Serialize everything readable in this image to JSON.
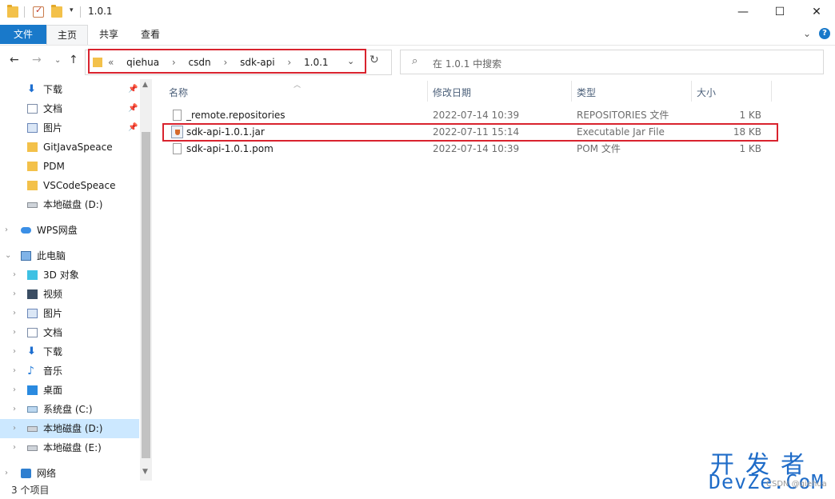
{
  "window": {
    "title": "1.0.1",
    "controls": {
      "minimize": "—",
      "maximize": "☐",
      "close": "✕"
    }
  },
  "ribbon": {
    "tabs": [
      "文件",
      "主页",
      "共享",
      "查看"
    ],
    "collapse_icon": "chevron-down-icon",
    "help_icon": "help-icon"
  },
  "address": {
    "overflow": "«",
    "path": [
      "qiehua",
      "csdn",
      "sdk-api",
      "1.0.1"
    ],
    "separator": "›"
  },
  "search": {
    "placeholder": "在 1.0.1 中搜索"
  },
  "sidebar": {
    "items": [
      {
        "label": "下载",
        "icon": "download-icon",
        "pinned": true
      },
      {
        "label": "文档",
        "icon": "document-icon",
        "pinned": true
      },
      {
        "label": "图片",
        "icon": "picture-icon",
        "pinned": true
      },
      {
        "label": "GitJavaSpeace",
        "icon": "folder-icon"
      },
      {
        "label": "PDM",
        "icon": "folder-icon"
      },
      {
        "label": "VSCodeSpeace",
        "icon": "folder-icon"
      },
      {
        "label": "本地磁盘 (D:)",
        "icon": "drive-icon"
      },
      {
        "label": "WPS网盘",
        "icon": "cloud-icon"
      },
      {
        "label": "此电脑",
        "icon": "computer-icon"
      },
      {
        "label": "3D 对象",
        "icon": "3d-objects-icon"
      },
      {
        "label": "视频",
        "icon": "video-icon"
      },
      {
        "label": "图片",
        "icon": "picture-icon"
      },
      {
        "label": "文档",
        "icon": "document-icon"
      },
      {
        "label": "下载",
        "icon": "download-icon"
      },
      {
        "label": "音乐",
        "icon": "music-icon"
      },
      {
        "label": "桌面",
        "icon": "desktop-icon"
      },
      {
        "label": "系统盘 (C:)",
        "icon": "system-drive-icon"
      },
      {
        "label": "本地磁盘 (D:)",
        "icon": "drive-icon",
        "selected": true
      },
      {
        "label": "本地磁盘 (E:)",
        "icon": "drive-icon"
      },
      {
        "label": "网络",
        "icon": "network-icon"
      }
    ]
  },
  "columns": [
    "名称",
    "修改日期",
    "类型",
    "大小"
  ],
  "files": [
    {
      "name": "_remote.repositories",
      "date": "2022-07-14 10:39",
      "type": "REPOSITORIES 文件",
      "size": "1 KB",
      "icon": "file-icon"
    },
    {
      "name": "sdk-api-1.0.1.jar",
      "date": "2022-07-11 15:14",
      "type": "Executable Jar File",
      "size": "18 KB",
      "icon": "jar-file-icon",
      "highlighted": true
    },
    {
      "name": "sdk-api-1.0.1.pom",
      "date": "2022-07-14 10:39",
      "type": "POM 文件",
      "size": "1 KB",
      "icon": "file-icon"
    }
  ],
  "status": {
    "text": "3 个项目"
  },
  "watermark": {
    "line1": "开发者",
    "line2": "DevZe.CoM",
    "small": "CSDN @qiehua"
  },
  "colors": {
    "accent": "#1979ca",
    "highlight_border": "#d9232e",
    "selection": "#cce8ff",
    "watermark": "#1f6cc8"
  }
}
